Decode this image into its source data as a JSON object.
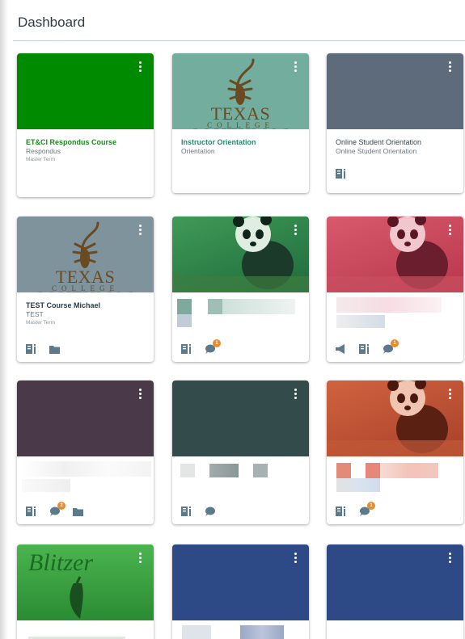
{
  "header": {
    "title": "Dashboard"
  },
  "colors": {
    "accent_green": "#008800",
    "badge": "#e98b2a",
    "icon": "#5b7a8c"
  },
  "cards": [
    {
      "title": "ET&CI Respondus Course",
      "code": "Respondus",
      "term": "Master Term",
      "hero_color": "#008a00",
      "title_color": "#1d8a1d",
      "badge": ""
    },
    {
      "title": "Instructor Orientation",
      "code": "Orientation",
      "term": "",
      "hero_color": "#72ad9e",
      "title_color": "#2b8a72",
      "logo_line1": "TEXAS SOUTHMOS",
      "logo_line2": "COLLEGE"
    },
    {
      "title": "Online Student Orientation",
      "code": "Online Student Orientation",
      "term": "",
      "hero_color": "#5d6b7a",
      "title_color": "#39474f"
    },
    {
      "title": "TEST Course Michael",
      "code": "TEST",
      "term": "Master Term",
      "hero_color": "#7f939c",
      "title_color": "#2d3b45",
      "logo_line1": "TEXAS SOUTHMOS",
      "logo_line2": "COLLEGE"
    },
    {
      "hero_color": "#2c8a4a",
      "badge": "1"
    },
    {
      "hero_color": "#cf4a5e",
      "badge": "1"
    },
    {
      "hero_color": "#4a3a49",
      "badge": "2"
    },
    {
      "hero_color": "#344b4b"
    },
    {
      "hero_color": "#c8583a",
      "badge": "1"
    },
    {
      "hero_color": "#2f9a3a",
      "logo_text": "Blitzer"
    },
    {
      "hero_color": "#2d4a86"
    },
    {
      "hero_color": "#2d4a86"
    }
  ]
}
